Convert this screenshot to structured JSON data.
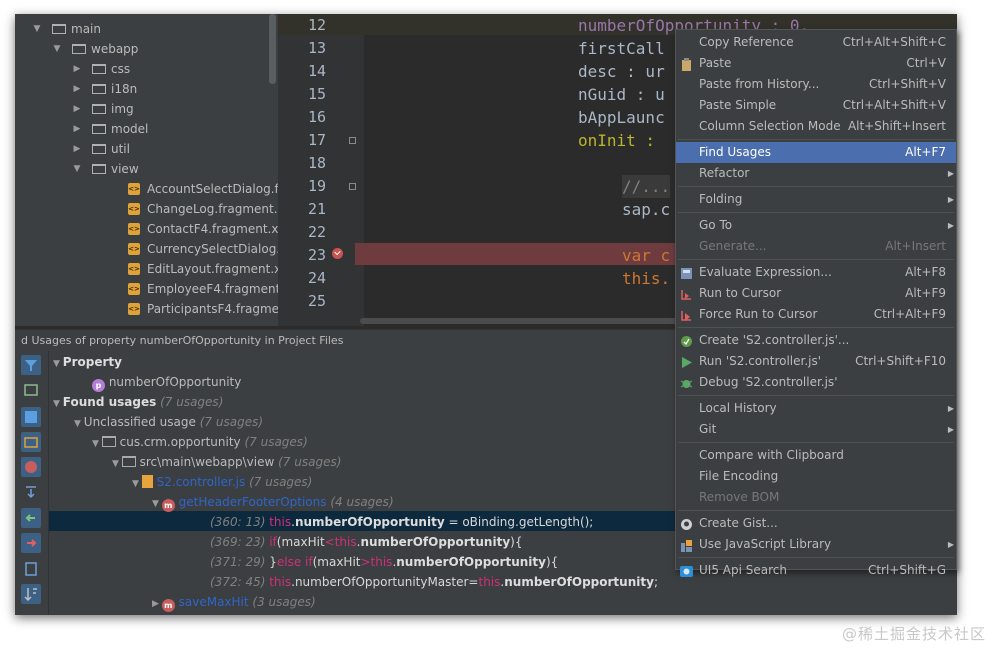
{
  "project_tree": {
    "rows": [
      {
        "label": "main",
        "depth": 0,
        "expanded": true,
        "type": "folder"
      },
      {
        "label": "webapp",
        "depth": 1,
        "expanded": true,
        "type": "folder"
      },
      {
        "label": "css",
        "depth": 2,
        "expanded": false,
        "type": "folder"
      },
      {
        "label": "i18n",
        "depth": 2,
        "expanded": false,
        "type": "folder"
      },
      {
        "label": "img",
        "depth": 2,
        "expanded": false,
        "type": "folder"
      },
      {
        "label": "model",
        "depth": 2,
        "expanded": false,
        "type": "folder"
      },
      {
        "label": "util",
        "depth": 2,
        "expanded": false,
        "type": "folder"
      },
      {
        "label": "view",
        "depth": 2,
        "expanded": true,
        "type": "folder"
      },
      {
        "label": "AccountSelectDialog.frag",
        "depth": 3,
        "type": "xml"
      },
      {
        "label": "ChangeLog.fragment.xml",
        "depth": 3,
        "type": "xml"
      },
      {
        "label": "ContactF4.fragment.xml",
        "depth": 3,
        "type": "xml"
      },
      {
        "label": "CurrencySelectDialog.frag",
        "depth": 3,
        "type": "xml"
      },
      {
        "label": "EditLayout.fragment.xml",
        "depth": 3,
        "type": "xml"
      },
      {
        "label": "EmployeeF4.fragment.xm",
        "depth": 3,
        "type": "xml"
      },
      {
        "label": "ParticipantsF4.fragment.x",
        "depth": 3,
        "type": "xml"
      }
    ]
  },
  "editor": {
    "lines": [
      {
        "num": "12",
        "text": "numberOfOpportunity : 0,",
        "color": "#9876aa"
      },
      {
        "num": "13",
        "text": "firstCall",
        "color": "#a9b7c6"
      },
      {
        "num": "14",
        "text": "desc : ur",
        "color": "#a9b7c6"
      },
      {
        "num": "15",
        "text": "nGuid : u",
        "color": "#a9b7c6"
      },
      {
        "num": "16",
        "text": "bAppLaunc",
        "color": "#a9b7c6"
      },
      {
        "num": "17",
        "text": "onInit :",
        "color": "#bbb529"
      },
      {
        "num": "18",
        "text": "",
        "color": "#a9b7c6"
      },
      {
        "num": "19",
        "text": "//...",
        "color": "#808080"
      },
      {
        "num": "21",
        "text": "sap.c",
        "color": "#a9b7c6"
      },
      {
        "num": "22",
        "text": "",
        "color": "#a9b7c6"
      },
      {
        "num": "23",
        "text": "var c",
        "color": "#cc7832"
      },
      {
        "num": "24",
        "text": "this.",
        "color": "#cc7832"
      },
      {
        "num": "25",
        "text": "",
        "color": "#a9b7c6"
      }
    ]
  },
  "find_panel": {
    "title": "d Usages of property numberOfOpportunity in Project Files",
    "property_label": "Property",
    "property_name": "numberOfOpportunity",
    "found_label": "Found usages",
    "found_count": "(7 usages)",
    "unclassified_label": "Unclassified usage",
    "unclassified_count": "(7 usages)",
    "package_label": "cus.crm.opportunity",
    "package_count": "(7 usages)",
    "dir_label": "src\\main\\webapp\\view",
    "dir_count": "(7 usages)",
    "file_label": "S2.controller.js",
    "file_count": "(7 usages)",
    "method1_label": "getHeaderFooterOptions",
    "method1_count": "(4 usages)",
    "method2_label": "saveMaxHit",
    "method2_count": "(3 usages)",
    "usages": [
      {
        "loc": "(360: 13)",
        "parts": [
          [
            "pink",
            "this"
          ],
          [
            "dot",
            "."
          ],
          [
            "bold",
            "numberOfOpportunity"
          ],
          [
            "plain",
            " = oBinding.getLength();"
          ]
        ]
      },
      {
        "loc": "(369: 23)",
        "parts": [
          [
            "pink",
            "if"
          ],
          [
            "plain",
            "(maxHit"
          ],
          [
            "pink",
            "<this"
          ],
          [
            "plain",
            "."
          ],
          [
            "bold",
            "numberOfOpportunity"
          ],
          [
            "plain",
            "){"
          ]
        ]
      },
      {
        "loc": "(371: 29)",
        "parts": [
          [
            "plain",
            "}"
          ],
          [
            "pink",
            "else if"
          ],
          [
            "plain",
            "(maxHit"
          ],
          [
            "pink",
            ">this"
          ],
          [
            "plain",
            "."
          ],
          [
            "bold",
            "numberOfOpportunity"
          ],
          [
            "plain",
            "){"
          ]
        ]
      },
      {
        "loc": "(372: 45)",
        "parts": [
          [
            "pink",
            "this"
          ],
          [
            "plain",
            ".numberOfOpportunityMaster="
          ],
          [
            "pink",
            "this"
          ],
          [
            "plain",
            "."
          ],
          [
            "bold",
            "numberOfOpportunity"
          ],
          [
            "plain",
            ";"
          ]
        ]
      }
    ]
  },
  "context_menu": {
    "items": [
      {
        "label": "Copy Reference",
        "shortcut": "Ctrl+Alt+Shift+C",
        "icon": "none"
      },
      {
        "label": "Paste",
        "shortcut": "Ctrl+V",
        "icon": "paste-icon"
      },
      {
        "label": "Paste from History...",
        "shortcut": "Ctrl+Shift+V"
      },
      {
        "label": "Paste Simple",
        "shortcut": "Ctrl+Alt+Shift+V"
      },
      {
        "label": "Column Selection Mode",
        "shortcut": "Alt+Shift+Insert"
      },
      {
        "sep": true
      },
      {
        "label": "Find Usages",
        "shortcut": "Alt+F7",
        "highlight": true
      },
      {
        "label": "Refactor",
        "submenu": true
      },
      {
        "sep": true
      },
      {
        "label": "Folding",
        "submenu": true
      },
      {
        "sep": true
      },
      {
        "label": "Go To",
        "submenu": true
      },
      {
        "label": "Generate...",
        "shortcut": "Alt+Insert",
        "disabled": true
      },
      {
        "sep": true
      },
      {
        "label": "Evaluate Expression...",
        "shortcut": "Alt+F8",
        "icon": "calculator-icon"
      },
      {
        "label": "Run to Cursor",
        "shortcut": "Alt+F9",
        "icon": "run-to-cursor-icon"
      },
      {
        "label": "Force Run to Cursor",
        "shortcut": "Ctrl+Alt+F9",
        "icon": "force-run-to-cursor-icon"
      },
      {
        "sep": true
      },
      {
        "label": "Create 'S2.controller.js'...",
        "icon": "create-config-icon"
      },
      {
        "label": "Run 'S2.controller.js'",
        "shortcut": "Ctrl+Shift+F10",
        "icon": "run-icon"
      },
      {
        "label": "Debug 'S2.controller.js'",
        "icon": "debug-icon"
      },
      {
        "sep": true
      },
      {
        "label": "Local History",
        "submenu": true
      },
      {
        "label": "Git",
        "submenu": true
      },
      {
        "sep": true
      },
      {
        "label": "Compare with Clipboard"
      },
      {
        "label": "File Encoding"
      },
      {
        "label": "Remove BOM",
        "disabled": true
      },
      {
        "sep": true
      },
      {
        "label": "Create Gist...",
        "icon": "github-icon"
      },
      {
        "label": "Use JavaScript Library",
        "submenu": true,
        "icon": "js-library-icon"
      },
      {
        "sep": true
      },
      {
        "label": "UI5 Api Search",
        "shortcut": "Ctrl+Shift+G",
        "icon": "ui5-icon"
      }
    ]
  },
  "watermark": "@稀土掘金技术社区",
  "colors": {
    "highlight": "#4b6eaf",
    "breakpoint_line": "#6e3b3f",
    "selected_usage_row": "#0d293e"
  }
}
